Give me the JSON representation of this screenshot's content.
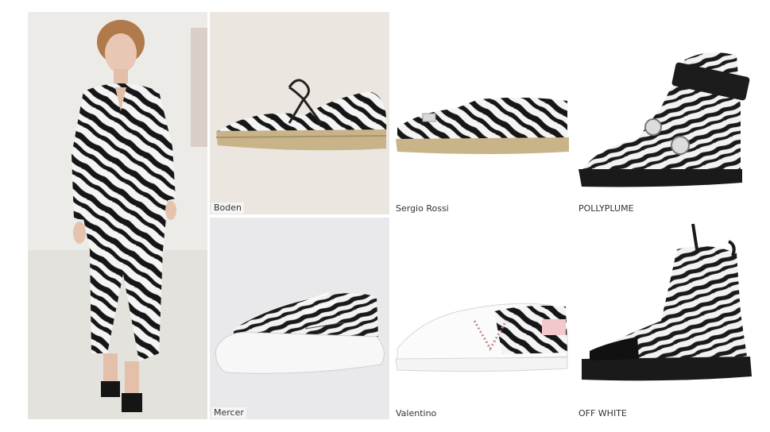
{
  "products": [
    {
      "label": "Boden"
    },
    {
      "label": "Sergio Rossi"
    },
    {
      "label": "POLLYPLUME"
    },
    {
      "label": "Mercer"
    },
    {
      "label": "Valentino"
    },
    {
      "label": "OFF WHITE"
    }
  ],
  "colors": {
    "zebra_dark": "#161616",
    "zebra_light": "#f4f4f4",
    "jute": "#c9b48a",
    "panel_beige": "#ebe6df",
    "panel_grey": "#e9e9eb",
    "blush": "#f2c8cc"
  }
}
